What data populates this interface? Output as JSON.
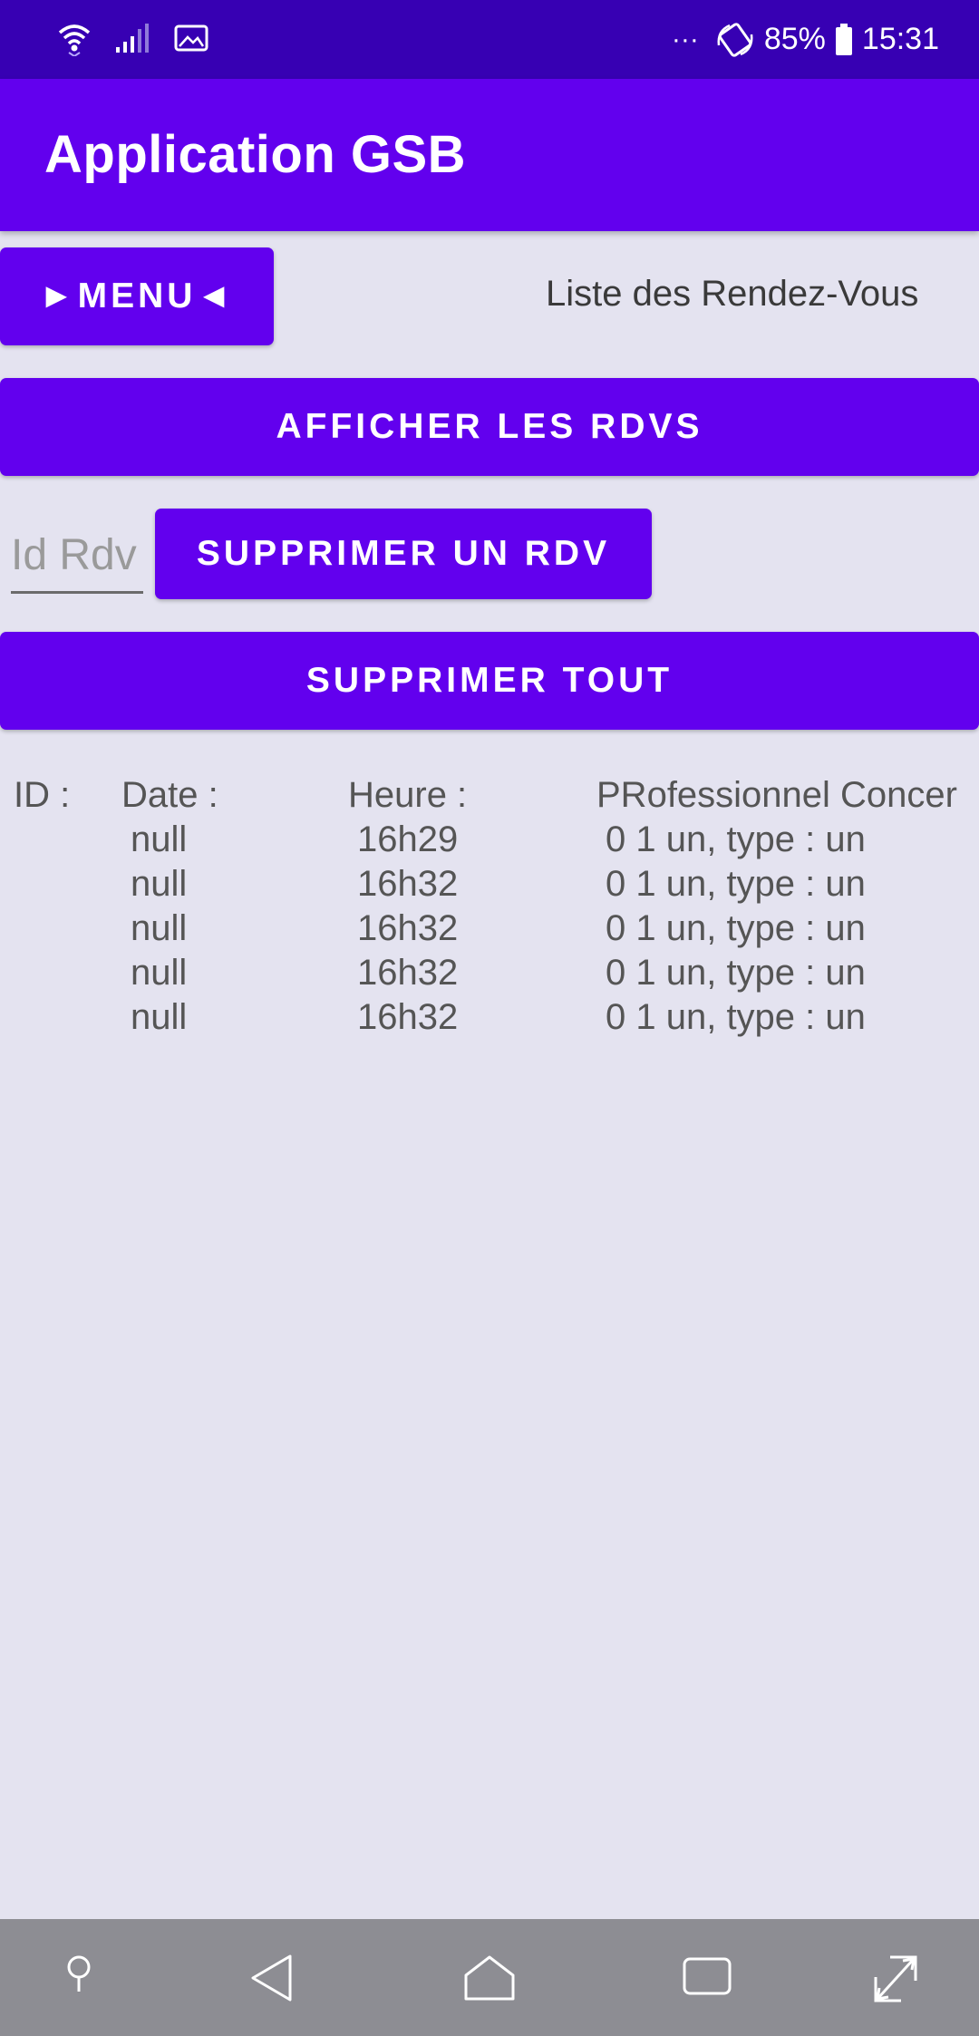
{
  "status_bar": {
    "battery": "85%",
    "time": "15:31",
    "notification_dots": "···"
  },
  "app_bar": {
    "title": "Application GSB"
  },
  "toolbar": {
    "menu_label": "►MENU◄",
    "page_subtitle": "Liste des Rendez-Vous"
  },
  "actions": {
    "show_label": "AFFICHER LES RDVS",
    "delete_one_label": "SUPPRIMER UN RDV",
    "delete_all_label": "SUPPRIMER TOUT",
    "id_placeholder": "Id Rdv",
    "id_value": ""
  },
  "table": {
    "headers": [
      "ID :",
      "Date :",
      "Heure :",
      "PRofessionnel Concer"
    ],
    "rows": [
      {
        "date": "null",
        "heure": "16h29",
        "professionnel": "0 1 un, type : un"
      },
      {
        "date": "null",
        "heure": "16h32",
        "professionnel": "0 1 un, type : un"
      },
      {
        "date": "null",
        "heure": "16h32",
        "professionnel": "0 1 un, type : un"
      },
      {
        "date": "null",
        "heure": "16h32",
        "professionnel": "0 1 un, type : un"
      },
      {
        "date": "null",
        "heure": "16h32",
        "professionnel": "0 1 un, type : un"
      }
    ]
  },
  "nav_bar": {
    "icons": [
      "pin-icon",
      "back-icon",
      "home-icon",
      "recents-icon",
      "expand-icon"
    ]
  },
  "colors": {
    "status_bar": "#3700b3",
    "primary": "#6200ee",
    "background": "#e4e3f0",
    "nav_bar": "#8d8d93"
  }
}
